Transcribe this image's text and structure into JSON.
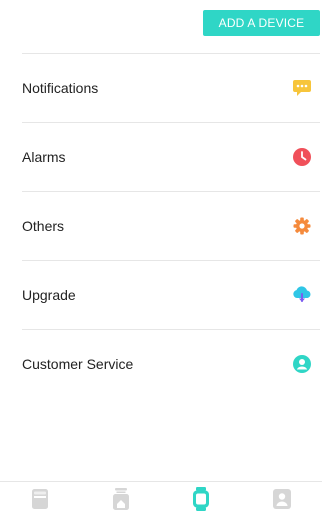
{
  "header": {
    "add_device_label": "ADD A DEVICE"
  },
  "menu": {
    "items": [
      {
        "label": "Notifications",
        "icon": "chat-bubble-icon",
        "color": "#f7c53b"
      },
      {
        "label": "Alarms",
        "icon": "clock-icon",
        "color": "#f0505a"
      },
      {
        "label": "Others",
        "icon": "gear-icon",
        "color": "#f58a3c"
      },
      {
        "label": "Upgrade",
        "icon": "cloud-download-icon",
        "color": "#2fc6e6"
      },
      {
        "label": "Customer Service",
        "icon": "user-icon",
        "color": "#2fd6c6"
      }
    ]
  },
  "tabbar": {
    "tabs": [
      {
        "icon": "card-icon",
        "active": false
      },
      {
        "icon": "home-jar-icon",
        "active": false
      },
      {
        "icon": "watch-icon",
        "active": true
      },
      {
        "icon": "profile-icon",
        "active": false
      }
    ],
    "active_color": "#2fd6c6",
    "inactive_color": "#d6d6d6"
  }
}
